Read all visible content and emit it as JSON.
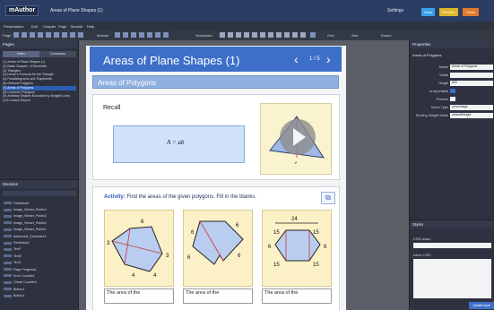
{
  "topbar": {
    "logo": "mAuthor",
    "title": "Areas of Plane Shapes (1)",
    "settings": "Settings",
    "btn_save": "Save",
    "btn_preview": "Preview",
    "btn_close": "Close"
  },
  "menu": [
    "Presentation",
    "Edit",
    "Chapter",
    "Page",
    "Module",
    "Help"
  ],
  "toolbar": {
    "page": "Page",
    "module": "Module",
    "semantics": "Semantics",
    "grid": "Grid",
    "size": "Size",
    "rulers": "Rulers"
  },
  "pages": {
    "title": "Pages",
    "tabs": [
      "Main",
      "Commons"
    ],
    "items": [
      "(1) Areas of Plane Shapes (1)",
      "(2) Basic Shapes - A Reminder",
      "(3) Triangles",
      "(4) Heron's Formula for the Triangle",
      "(5) Parallelograms and Trapezoids",
      "(6) General Polygons",
      "(7) Areas of Polygons",
      "(8) Common Polygons",
      "(9) Arbitrary Shapes Bounded by Straight Lines",
      "(10) Lesson Report"
    ],
    "selected": 6
  },
  "modules": {
    "title": "Modules",
    "items": [
      "Feedback1",
      "Image_Viewer_Public4",
      "Image_Viewer_Public3",
      "Image_Viewer_Public2",
      "Image_Viewer_Public1",
      "Advanced_Connector1",
      "Feedback1",
      "Text7",
      "Text5",
      "Text1",
      "Page Progress1",
      "Error Counter1",
      "Check Counter1",
      "Button1",
      "Button2"
    ]
  },
  "page": {
    "title": "Areas of Plane Shapes (1)",
    "counter": "1 / 5",
    "subheader": "Areas of Polygons",
    "recall_label": "Recall",
    "formula": "A = ab",
    "video_label": "e",
    "activity_prefix": "Activity:",
    "activity_text": " Find the areas of the given polygons. Fill in the blanks.",
    "answer_prefix": "The area of the"
  },
  "shape1_labels": [
    "3",
    "6",
    "3",
    "4",
    "4"
  ],
  "shape2_labels": [
    "6",
    "6",
    "6",
    "6"
  ],
  "shape3_labels": [
    "24",
    "15",
    "15",
    "6",
    "6",
    "15",
    "15"
  ],
  "properties": {
    "title": "Properties",
    "subtitle": "Areas of Polygons",
    "rows": [
      {
        "label": "Name",
        "value": "Areas of Polygons"
      },
      {
        "label": "Width",
        "value": ""
      },
      {
        "label": "Height",
        "value": "800"
      },
      {
        "label": "Is reportable",
        "value": "checkbox"
      },
      {
        "label": "Preview",
        "value": ""
      },
      {
        "label": "Score Type",
        "value": "percentage"
      },
      {
        "label": "Scoring Weight Mode",
        "value": "defaultWeight"
      }
    ]
  },
  "styles": {
    "title": "Styles",
    "css_class": "CSS class:",
    "inline_css": "Inline CSS:",
    "update": "Update style"
  },
  "colors": {
    "header_blue": "#3d6fc9",
    "selection": "#2c5fb3",
    "preview_btn": "#d9b62a",
    "close_btn": "#e07a2c",
    "save_btn": "#3aa0e8"
  }
}
